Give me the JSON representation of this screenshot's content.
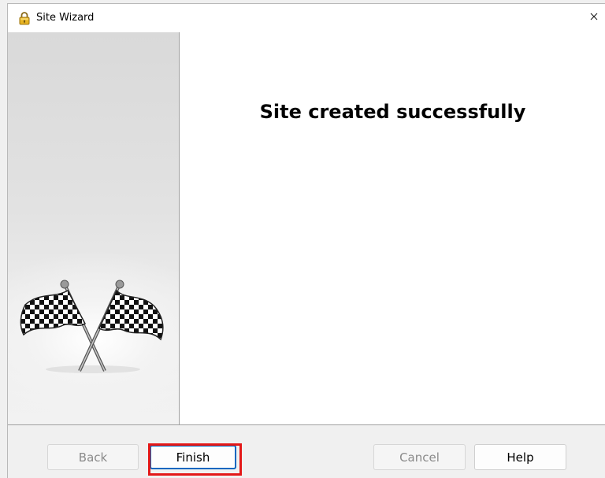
{
  "window": {
    "title": "Site Wizard",
    "title_icon": "padlock-icon",
    "close_icon": "close-icon",
    "close_glyph": "✕"
  },
  "main": {
    "headline": "Site created successfully",
    "side_image": "checkered-flags-icon"
  },
  "buttons": {
    "back": "Back",
    "finish": "Finish",
    "cancel": "Cancel",
    "help": "Help"
  },
  "annotation": {
    "highlight_target": "finish-button",
    "highlight_color": "#e31818"
  },
  "colors": {
    "focus_border": "#0067c0",
    "panel_border": "#a0a0a0",
    "padlock": "#e8b423"
  }
}
